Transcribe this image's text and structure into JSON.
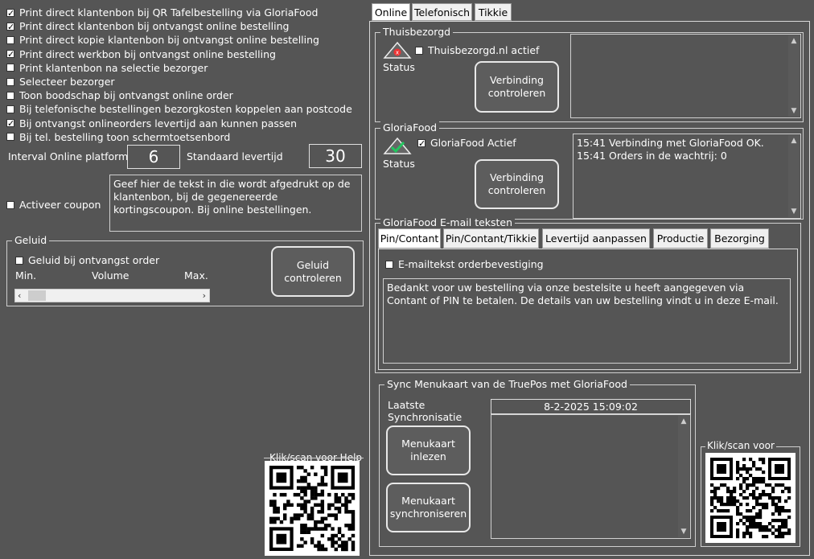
{
  "left": {
    "options": [
      {
        "label": "Print direct klantenbon bij QR Tafelbestelling via GloriaFood",
        "checked": true
      },
      {
        "label": "Print direct klantenbon bij ontvangst online bestelling",
        "checked": true
      },
      {
        "label": "Print direct kopie klantenbon bij ontvangst online bestelling",
        "checked": false
      },
      {
        "label": "Print direct werkbon bij ontvangst online bestelling",
        "checked": true
      },
      {
        "label": "Print klantenbon na selectie bezorger",
        "checked": false
      },
      {
        "label": "Selecteer bezorger",
        "checked": false
      },
      {
        "label": "Toon boodschap bij ontvangst online order",
        "checked": false
      },
      {
        "label": "Bij telefonische bestellingen bezorgkosten koppelen aan postcode",
        "checked": false
      },
      {
        "label": "Bij ontvangst onlineorders levertijd aan kunnen passen",
        "checked": true
      },
      {
        "label": "Bij tel. bestelling toon schermtoetsenbord",
        "checked": false
      }
    ],
    "interval_label": "Interval Online platforms",
    "interval_value": "6",
    "levertijd_label": "Standaard levertijd",
    "levertijd_value": "30",
    "coupon_label": "Activeer coupon",
    "coupon_checked": false,
    "coupon_text": "Geef hier de tekst in die wordt afgedrukt op de klantenbon, bij de gegenereerde kortingscoupon. Bij online bestellingen.",
    "geluid": {
      "legend": "Geluid",
      "checkbox_label": "Geluid bij ontvangst order",
      "checked": false,
      "min_label": "Min.",
      "volume_label": "Volume",
      "max_label": "Max.",
      "volume_level": 0.0,
      "button": "Geluid controleren"
    },
    "help_legend": "Klik/scan voor Help"
  },
  "tabs": [
    "Online",
    "Telefonisch",
    "Tikkie"
  ],
  "active_tab": 0,
  "thuisbezorgd": {
    "legend": "Thuisbezorgd",
    "checkbox_label": "Thuisbezorgd.nl actief",
    "checked": false,
    "status_label": "Status",
    "button": "Verbinding controleren",
    "status_icon": "error-warning-icon"
  },
  "gloriafood": {
    "legend": "GloriaFood",
    "checkbox_label": "GloriaFood Actief",
    "checked": true,
    "status_label": "Status",
    "button": "Verbinding controleren",
    "status_icon": "ok-warning-icon",
    "log": [
      "15:41 Verbinding met GloriaFood OK.",
      "15:41 Orders in de wachtrij: 0"
    ]
  },
  "email": {
    "legend": "GloriaFood E-mail teksten",
    "tabs": [
      "Pin/Contant",
      "Pin/Contant/Tikkie",
      "Levertijd aanpassen",
      "Productie",
      "Bezorging"
    ],
    "active_tab": 0,
    "checkbox_label": "E-mailtekst orderbevestiging",
    "checked": false,
    "text": "Bedankt voor uw bestelling via onze bestelsite u heeft aangegeven via Contant of PIN te betalen. De details van uw bestelling vindt u in deze E-mail."
  },
  "sync": {
    "legend": "Sync Menukaart van de TruePos met GloriaFood",
    "last_label": "Laatste Synchronisatie",
    "last_value": "8-2-2025 15:09:02",
    "btn_read": "Menukaart inlezen",
    "btn_sync": "Menukaart synchroniseren"
  },
  "right_qr_legend": "Klik/scan voor"
}
